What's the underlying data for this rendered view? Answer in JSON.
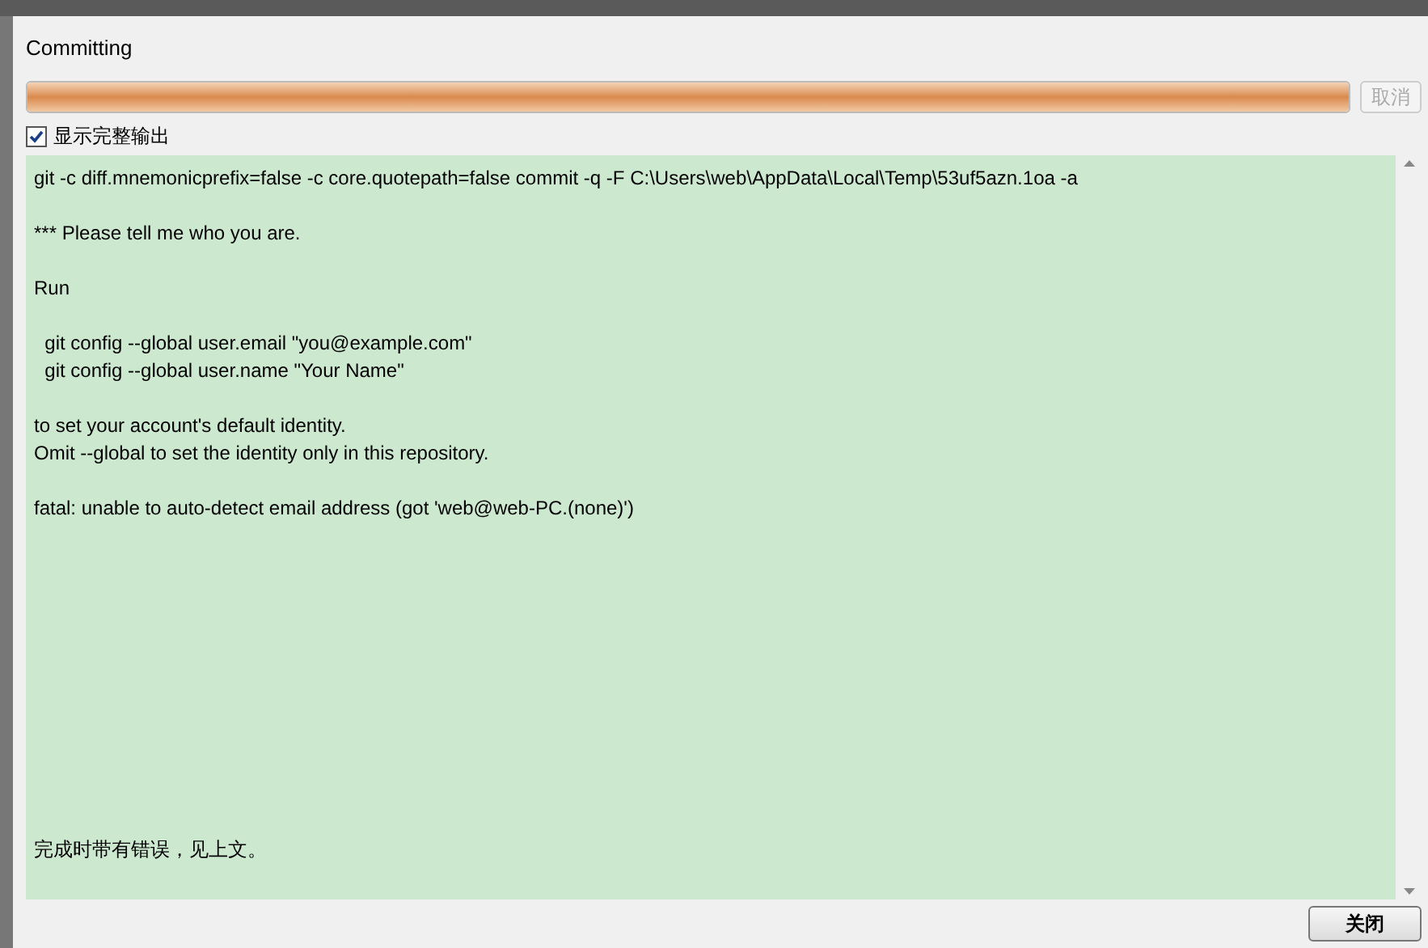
{
  "dialog": {
    "title": "Committing"
  },
  "progress": {
    "level": 1
  },
  "cancel_button": {
    "label": "取消",
    "disabled": true
  },
  "show_output": {
    "label": "显示完整输出",
    "checked": true
  },
  "output": {
    "blocks": [
      [
        "git -c diff.mnemonicprefix=false -c core.quotepath=false commit -q -F C:\\Users\\web\\AppData\\Local\\Temp\\53uf5azn.1oa -a"
      ],
      [
        "*** Please tell me who you are."
      ],
      [
        "Run"
      ],
      [
        "  git config --global user.email \"you@example.com\"",
        "  git config --global user.name \"Your Name\""
      ],
      [
        "to set your account's default identity.",
        "Omit --global to set the identity only in this repository."
      ],
      [
        "fatal: unable to auto-detect email address (got 'web@web-PC.(none)')"
      ]
    ],
    "result": "完成时带有错误，见上文。"
  },
  "close_button": {
    "label": "关闭"
  }
}
